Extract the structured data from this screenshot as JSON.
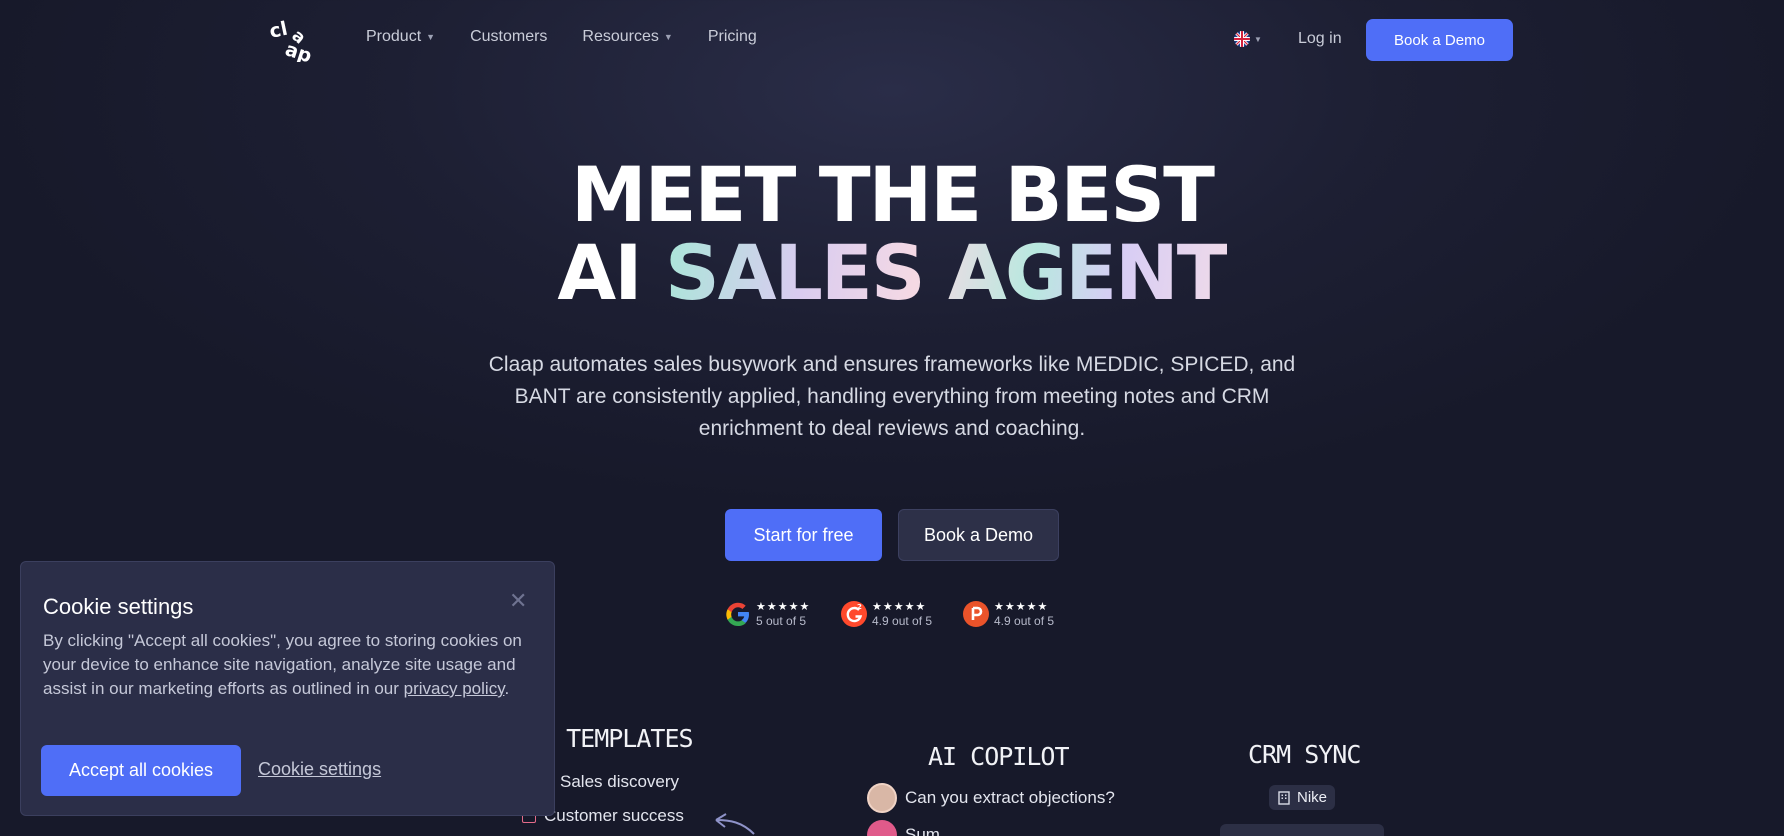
{
  "nav": {
    "logo_alt": "claap",
    "links": [
      {
        "label": "Product",
        "has_dropdown": true
      },
      {
        "label": "Customers",
        "has_dropdown": false
      },
      {
        "label": "Resources",
        "has_dropdown": true
      },
      {
        "label": "Pricing",
        "has_dropdown": false
      }
    ],
    "language_icon": "uk-flag-icon",
    "login_label": "Log in",
    "demo_label": "Book a Demo"
  },
  "hero": {
    "title_line1": "MEET THE BEST",
    "title_line2_prefix": "AI",
    "title_line2_highlight": "SALES AGENT",
    "subtitle": "Claap automates sales busywork and ensures frameworks like MEDDIC, SPICED, and BANT are consistently applied, handling everything from meeting notes and CRM enrichment to deal reviews and coaching.",
    "cta_primary": "Start for free",
    "cta_secondary": "Book a Demo"
  },
  "ratings": [
    {
      "source_icon": "google-icon",
      "stars": "★★★★★",
      "score": "5 out of 5"
    },
    {
      "source_icon": "g2-icon",
      "stars": "★★★★★",
      "score": "4.9 out of 5"
    },
    {
      "source_icon": "producthunt-icon",
      "stars": "★★★★★",
      "score": "4.9 out of 5"
    }
  ],
  "features": {
    "templates": {
      "title": "E TEMPLATES",
      "items": [
        "Sales discovery",
        "Customer success"
      ]
    },
    "copilot": {
      "title": "AI COPILOT",
      "items": [
        "Can you extract objections?",
        "Sum"
      ]
    },
    "crm": {
      "title": "CRM SYNC",
      "chips": [
        "Nike"
      ]
    }
  },
  "cookie": {
    "title": "Cookie settings",
    "body_prefix": "By clicking \"Accept all cookies\", you agree to storing cookies on your device to enhance site navigation, analyze site usage and assist in our marketing efforts as outlined in our ",
    "body_link": "privacy policy",
    "body_suffix": ".",
    "accept_label": "Accept all cookies",
    "settings_label": "Cookie settings"
  },
  "colors": {
    "accent": "#4f6ef7",
    "background": "#1d1f33",
    "panel": "#2b2e48"
  }
}
